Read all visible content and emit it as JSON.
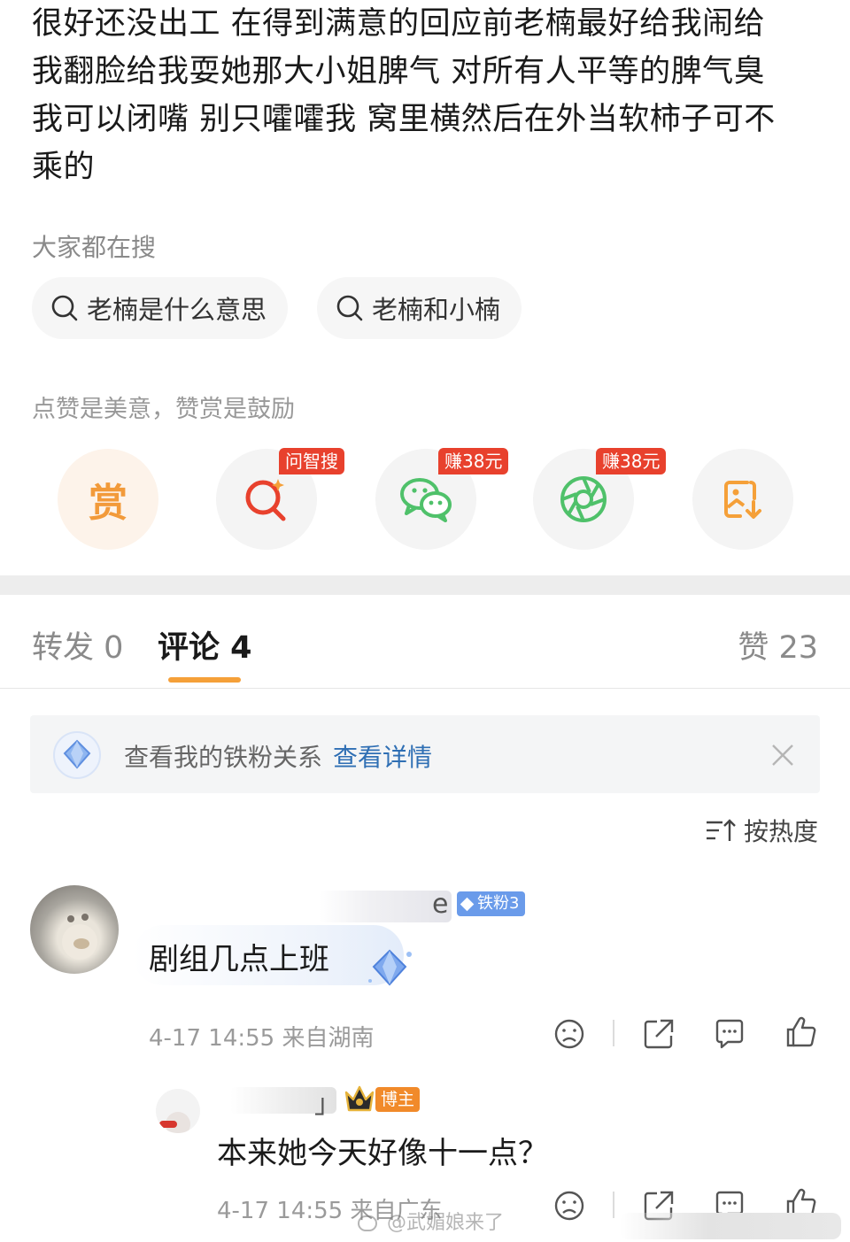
{
  "post": {
    "lines": [
      "很好还没出工 在得到满意的回应前老楠最好给我闹给",
      "我翻脸给我耍她那大小姐脾气 对所有人平等的脾气臭",
      "我可以闭嘴 别只嚯嚯我 窝里横然后在外当软柿子可不",
      "乘的"
    ]
  },
  "search": {
    "heading": "大家都在搜",
    "chips": [
      "老楠是什么意思",
      "老楠和小楠"
    ]
  },
  "reward": {
    "slogan": "点赞是美意，赞赏是鼓励",
    "shang_label": "赏",
    "badges": [
      "问智搜",
      "赚38元",
      "赚38元"
    ]
  },
  "tabs": {
    "repost": "转发 0",
    "comment": "评论 4",
    "like": "赞 23"
  },
  "fan_bar": {
    "text": "查看我的铁粉关系",
    "link": "查看详情"
  },
  "sort": {
    "label": "按热度"
  },
  "comments": [
    {
      "nickname_tail": "e",
      "fan_tag": "铁粉3",
      "text": "剧组几点上班",
      "meta": "4-17 14:55 来自湖南"
    }
  ],
  "reply": {
    "nickname_tail": "」",
    "tag": "博主",
    "text": "本来她今天好像十一点？",
    "meta": "4-17 14:55 来自广东"
  },
  "watermark": "@武媚娘来了",
  "colors": {
    "accent_orange": "#f5a039",
    "badge_red": "#e8412d",
    "link_blue": "#2f6fb4",
    "wechat_green": "#4fc16a",
    "fan_tag_blue": "#6a9bea",
    "bozhu_orange": "#f18a2a"
  }
}
